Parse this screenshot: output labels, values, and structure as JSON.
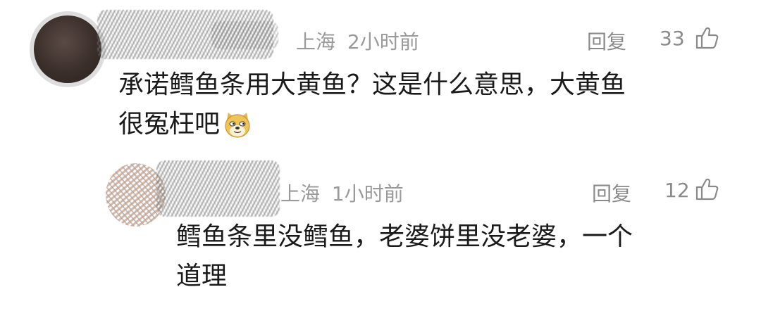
{
  "comments": [
    {
      "location": "上海",
      "time": "2小时前",
      "reply_label": "回复",
      "like_count": "33",
      "like_icon": "thumb-up-icon",
      "content_lines": [
        "承诺鳕鱼条用大黄鱼？这是什么意思，大黄鱼",
        "很冤枉吧"
      ],
      "emoji": "doge-emoji"
    },
    {
      "location": "上海",
      "time": "1小时前",
      "reply_label": "回复",
      "like_count": "12",
      "like_icon": "thumb-up-icon",
      "content_lines": [
        "鳕鱼条里没鳕鱼，老婆饼里没老婆，一个",
        "道理"
      ]
    }
  ]
}
